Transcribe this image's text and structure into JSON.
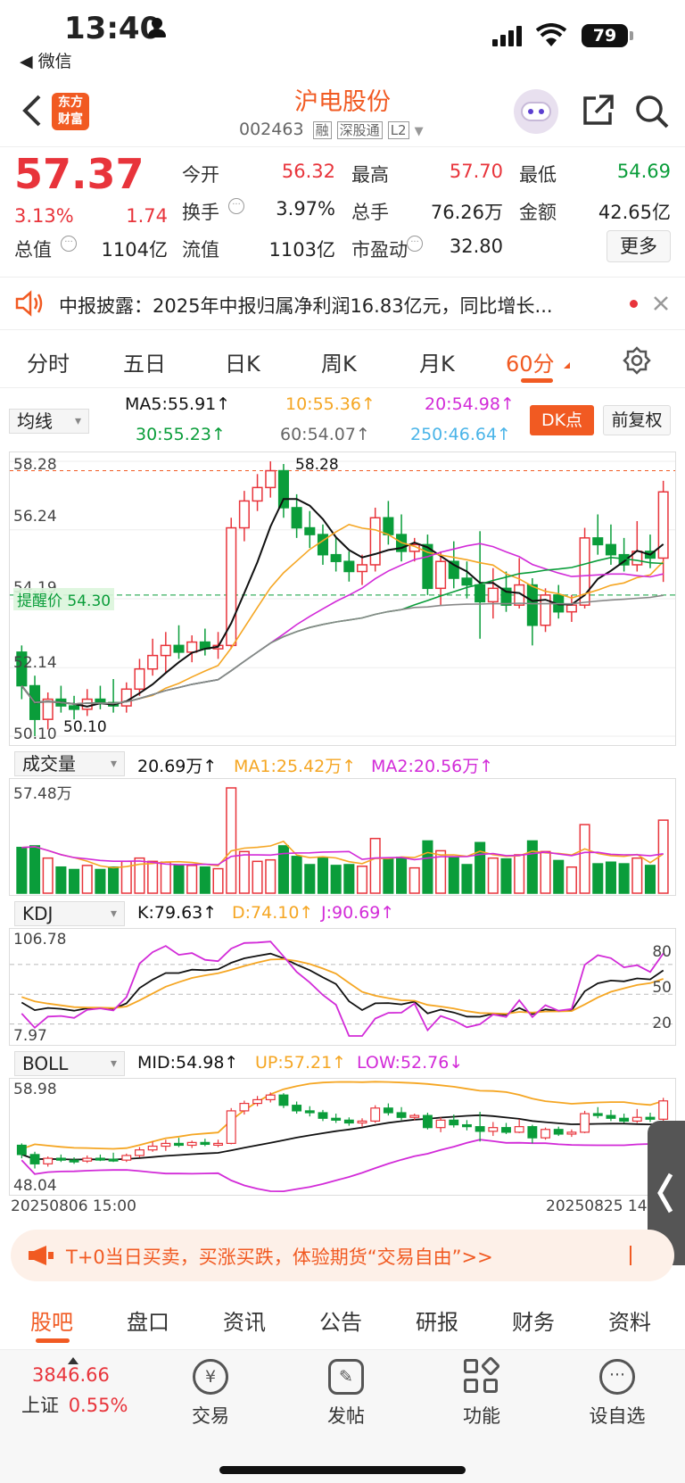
{
  "status_bar": {
    "time": "13:40",
    "battery": "79",
    "back_app": "◀ 微信"
  },
  "header": {
    "title": "沪电股份",
    "code": "002463",
    "badges": [
      "融",
      "深股通",
      "L2"
    ],
    "logo_line1": "东方",
    "logo_line2": "财富"
  },
  "quote": {
    "price": "57.37",
    "change_pct": "3.13%",
    "change": "1.74",
    "rows": [
      [
        {
          "label": "今开",
          "value": "56.32",
          "color": "red"
        },
        {
          "label": "最高",
          "value": "57.70",
          "color": "red"
        },
        {
          "label": "最低",
          "value": "54.69",
          "color": "green"
        }
      ],
      [
        {
          "label": "换手",
          "value": "3.97%",
          "color": "black"
        },
        {
          "label": "总手",
          "value": "76.26万",
          "color": "black"
        },
        {
          "label": "金额",
          "value": "42.65亿",
          "color": "black"
        }
      ],
      [
        {
          "label": "总值",
          "value": "1104亿",
          "color": "black"
        },
        {
          "label": "流值",
          "value": "1103亿",
          "color": "black"
        },
        {
          "label": "市盈动",
          "value": "32.80",
          "color": "black"
        }
      ]
    ],
    "more_button": "更多"
  },
  "notice": {
    "text": "中报披露：2025年中报归属净利润16.83亿元，同比增长..."
  },
  "period_tabs": [
    "分时",
    "五日",
    "日K",
    "周K",
    "月K",
    "60分"
  ],
  "active_period": "60分",
  "ma_bar": {
    "selector": "均线",
    "ma5": "MA5:55.91↑",
    "ma10": "10:55.36↑",
    "ma20": "20:54.98↑",
    "ma30": "30:55.23↑",
    "ma60": "60:54.07↑",
    "ma250": "250:46.64↑",
    "dk_button": "DK点",
    "adjust_button": "前复权"
  },
  "kline": {
    "y_top": "58.28",
    "y_mid": "56.24",
    "y_alert": "54.19",
    "y_low1": "52.14",
    "y_bottom": "50.10",
    "alert_label": "提醒价 54.30",
    "max_label": "58.28",
    "min_label": "50.10"
  },
  "volume": {
    "selector": "成交量",
    "value": "20.69万↑",
    "ma1": "MA1:25.42万↑",
    "ma2": "MA2:20.56万↑",
    "y_top": "57.48万"
  },
  "kdj": {
    "selector": "KDJ",
    "k": "K:79.63↑",
    "d": "D:74.10↑",
    "j": "J:90.69↑",
    "y_top": "106.78",
    "y_bottom": "7.97",
    "levels": [
      "80",
      "50",
      "20"
    ]
  },
  "boll": {
    "selector": "BOLL",
    "mid": "MID:54.98↑",
    "up": "UP:57.21↑",
    "low": "LOW:52.76↓",
    "y_top": "58.98",
    "y_bottom": "48.04"
  },
  "time_axis": {
    "start": "20250806 15:00",
    "end": "20250825 14"
  },
  "promo": {
    "text": "T+0当日买卖，买涨买跌，体验期货“交易自由”>>"
  },
  "bottom_tabs": [
    "股吧",
    "盘口",
    "资讯",
    "公告",
    "研报",
    "财务",
    "资料"
  ],
  "active_bottom_tab": "股吧",
  "dock": {
    "index_value": "3846.66",
    "index_name": "上证",
    "index_change": "0.55%",
    "items": [
      "交易",
      "发帖",
      "功能",
      "设自选"
    ]
  },
  "chart_data": {
    "type": "candlestick",
    "candles": [
      [
        52.6,
        52.8,
        51.2,
        51.6
      ],
      [
        51.6,
        51.9,
        50.1,
        50.6
      ],
      [
        50.6,
        51.4,
        50.3,
        51.2
      ],
      [
        51.2,
        51.6,
        50.8,
        51.0
      ],
      [
        51.0,
        51.3,
        50.6,
        50.9
      ],
      [
        50.9,
        51.5,
        50.7,
        51.2
      ],
      [
        51.2,
        51.6,
        50.9,
        51.1
      ],
      [
        51.1,
        51.8,
        50.8,
        51.0
      ],
      [
        51.0,
        51.7,
        50.8,
        51.5
      ],
      [
        51.5,
        52.4,
        51.3,
        52.1
      ],
      [
        52.1,
        53.0,
        51.9,
        52.5
      ],
      [
        52.5,
        53.2,
        52.0,
        52.8
      ],
      [
        52.8,
        53.4,
        52.4,
        52.6
      ],
      [
        52.6,
        53.1,
        52.3,
        52.9
      ],
      [
        52.9,
        53.3,
        52.5,
        52.7
      ],
      [
        52.7,
        53.2,
        52.4,
        52.8
      ],
      [
        52.8,
        56.6,
        52.7,
        56.3
      ],
      [
        56.3,
        57.4,
        55.9,
        57.1
      ],
      [
        57.1,
        57.9,
        56.8,
        57.5
      ],
      [
        57.5,
        58.28,
        57.2,
        58.0
      ],
      [
        58.0,
        58.2,
        56.6,
        56.9
      ],
      [
        56.9,
        57.3,
        56.0,
        56.3
      ],
      [
        56.3,
        56.8,
        55.7,
        56.1
      ],
      [
        56.1,
        56.4,
        55.2,
        55.5
      ],
      [
        55.5,
        56.0,
        55.0,
        55.3
      ],
      [
        55.3,
        55.6,
        54.7,
        55.0
      ],
      [
        55.0,
        55.5,
        54.6,
        55.2
      ],
      [
        55.2,
        56.9,
        55.0,
        56.6
      ],
      [
        56.6,
        57.1,
        55.8,
        56.1
      ],
      [
        56.1,
        56.7,
        55.3,
        55.6
      ],
      [
        55.6,
        56.0,
        55.3,
        55.8
      ],
      [
        55.8,
        56.1,
        54.3,
        54.5
      ],
      [
        54.5,
        55.6,
        54.0,
        55.3
      ],
      [
        55.3,
        55.9,
        54.5,
        54.8
      ],
      [
        54.8,
        55.3,
        54.2,
        54.6
      ],
      [
        54.6,
        56.2,
        53.0,
        54.1
      ],
      [
        54.1,
        55.1,
        53.6,
        54.5
      ],
      [
        54.5,
        55.0,
        53.8,
        54.0
      ],
      [
        54.0,
        55.4,
        53.9,
        54.6
      ],
      [
        54.6,
        54.8,
        52.8,
        53.4
      ],
      [
        53.4,
        54.5,
        53.2,
        54.3
      ],
      [
        54.3,
        54.6,
        53.6,
        53.8
      ],
      [
        53.8,
        54.3,
        53.5,
        54.0
      ],
      [
        54.0,
        56.3,
        53.9,
        56.0
      ],
      [
        56.0,
        56.7,
        55.5,
        55.8
      ],
      [
        55.8,
        56.4,
        55.2,
        55.5
      ],
      [
        55.5,
        56.0,
        55.0,
        55.2
      ],
      [
        55.2,
        56.5,
        55.0,
        55.6
      ],
      [
        55.6,
        56.1,
        55.1,
        55.4
      ],
      [
        55.4,
        57.7,
        54.69,
        57.37
      ]
    ]
  }
}
